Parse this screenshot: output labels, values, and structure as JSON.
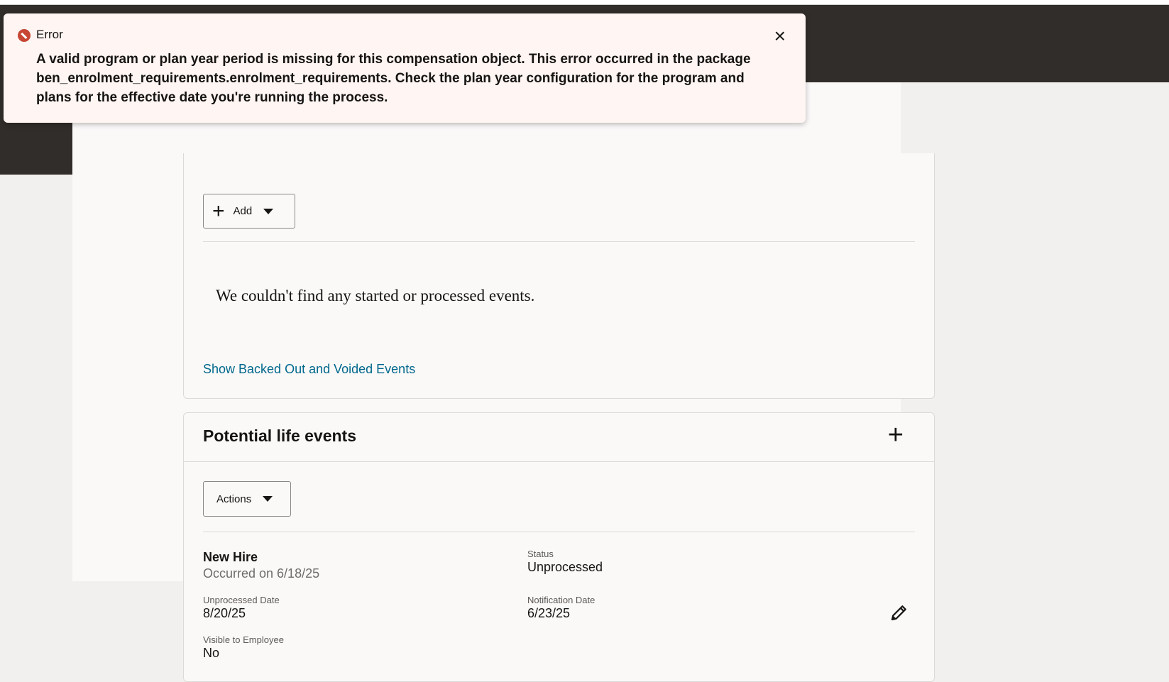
{
  "error": {
    "title": "Error",
    "message": "A valid program or plan year period is missing for this compensation object. This error occurred in the package ben_enrolment_requirements.enrolment_requirements. Check the plan year configuration for the program and plans for the effective date you're running the process.",
    "close_glyph": "×",
    "icon": "error-icon",
    "color": "#c74634"
  },
  "events": {
    "add_label": "Add",
    "empty_message": "We couldn't find any started or processed events.",
    "show_backed_out_link": "Show Backed Out and Voided Events"
  },
  "potential": {
    "title": "Potential life events",
    "actions_label": "Actions",
    "item": {
      "name": "New Hire",
      "occurred": "Occurred on 6/18/25",
      "status_label": "Status",
      "status_value": "Unprocessed",
      "unprocessed_date_label": "Unprocessed Date",
      "unprocessed_date_value": "8/20/25",
      "notification_date_label": "Notification Date",
      "notification_date_value": "6/23/25",
      "visible_label": "Visible to Employee",
      "visible_value": "No"
    }
  },
  "colors": {
    "header": "#312d2a",
    "link": "#00688c",
    "toast_bg": "#fff5f3"
  }
}
